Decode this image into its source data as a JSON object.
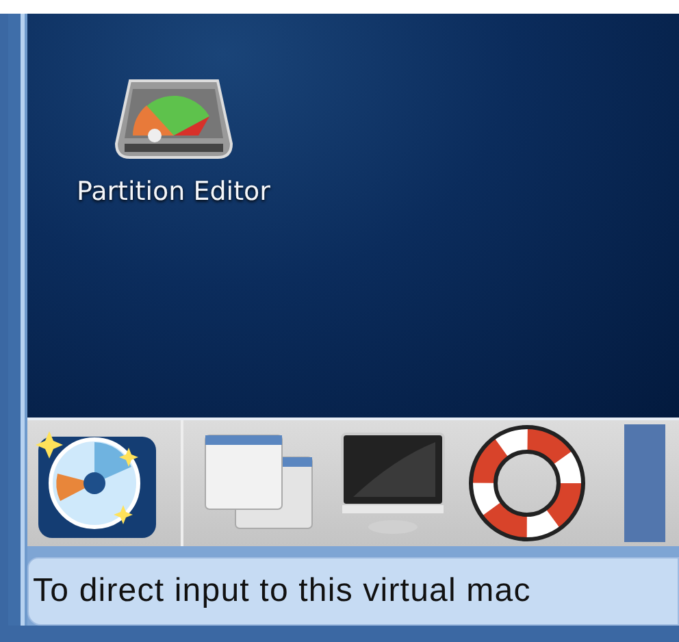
{
  "desktop": {
    "icons": [
      {
        "label": "Partition Editor"
      }
    ]
  },
  "taskbar": {
    "items": [
      {
        "kind": "disc"
      },
      {
        "kind": "windows"
      },
      {
        "kind": "monitor"
      },
      {
        "kind": "lifebuoy"
      },
      {
        "kind": "app"
      }
    ]
  },
  "status_bar": {
    "text": "To direct input to this virtual mac"
  }
}
